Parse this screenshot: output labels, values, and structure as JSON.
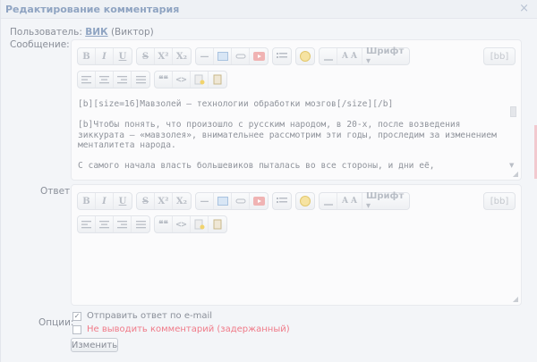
{
  "title": "Редактирование комментария",
  "close_symbol": "×",
  "user": {
    "label": "Пользователь:",
    "username": "ВИК",
    "realname": "(Виктор)"
  },
  "message_label": "Сообщение:",
  "reply_label": "Ответ:",
  "options_label": "Опции:",
  "toolbar": {
    "bold": "B",
    "italic": "I",
    "underline": "U",
    "strike": "S",
    "sup": "X²",
    "sub": "X₂",
    "hr": "—",
    "font": "Шрифт ▾",
    "text_color": "A",
    "size": "A A",
    "code": "<>",
    "quote": "❝❝",
    "bb": "[bb]"
  },
  "message_text": "[b][size=16]Мавзолей — технологии обработки мозгов[/size][/b]\n\n[b]Чтобы понять, что произошло с русским народом, в 20-х, после возведения зиккурата — «мавзолея», внимательнее рассмотрим эти годы, проследим за изменением менталитета народа.\n\nС самого начала власть большевиков пыталась во все стороны, и дни её,",
  "options": [
    {
      "label": "Отправить ответ по e-mail",
      "checked": true,
      "color": "#8a8f99"
    },
    {
      "label": "Не выводить комментарий (задержанный)",
      "checked": false,
      "color": "#f07a88"
    }
  ],
  "submit_label": "Изменить"
}
